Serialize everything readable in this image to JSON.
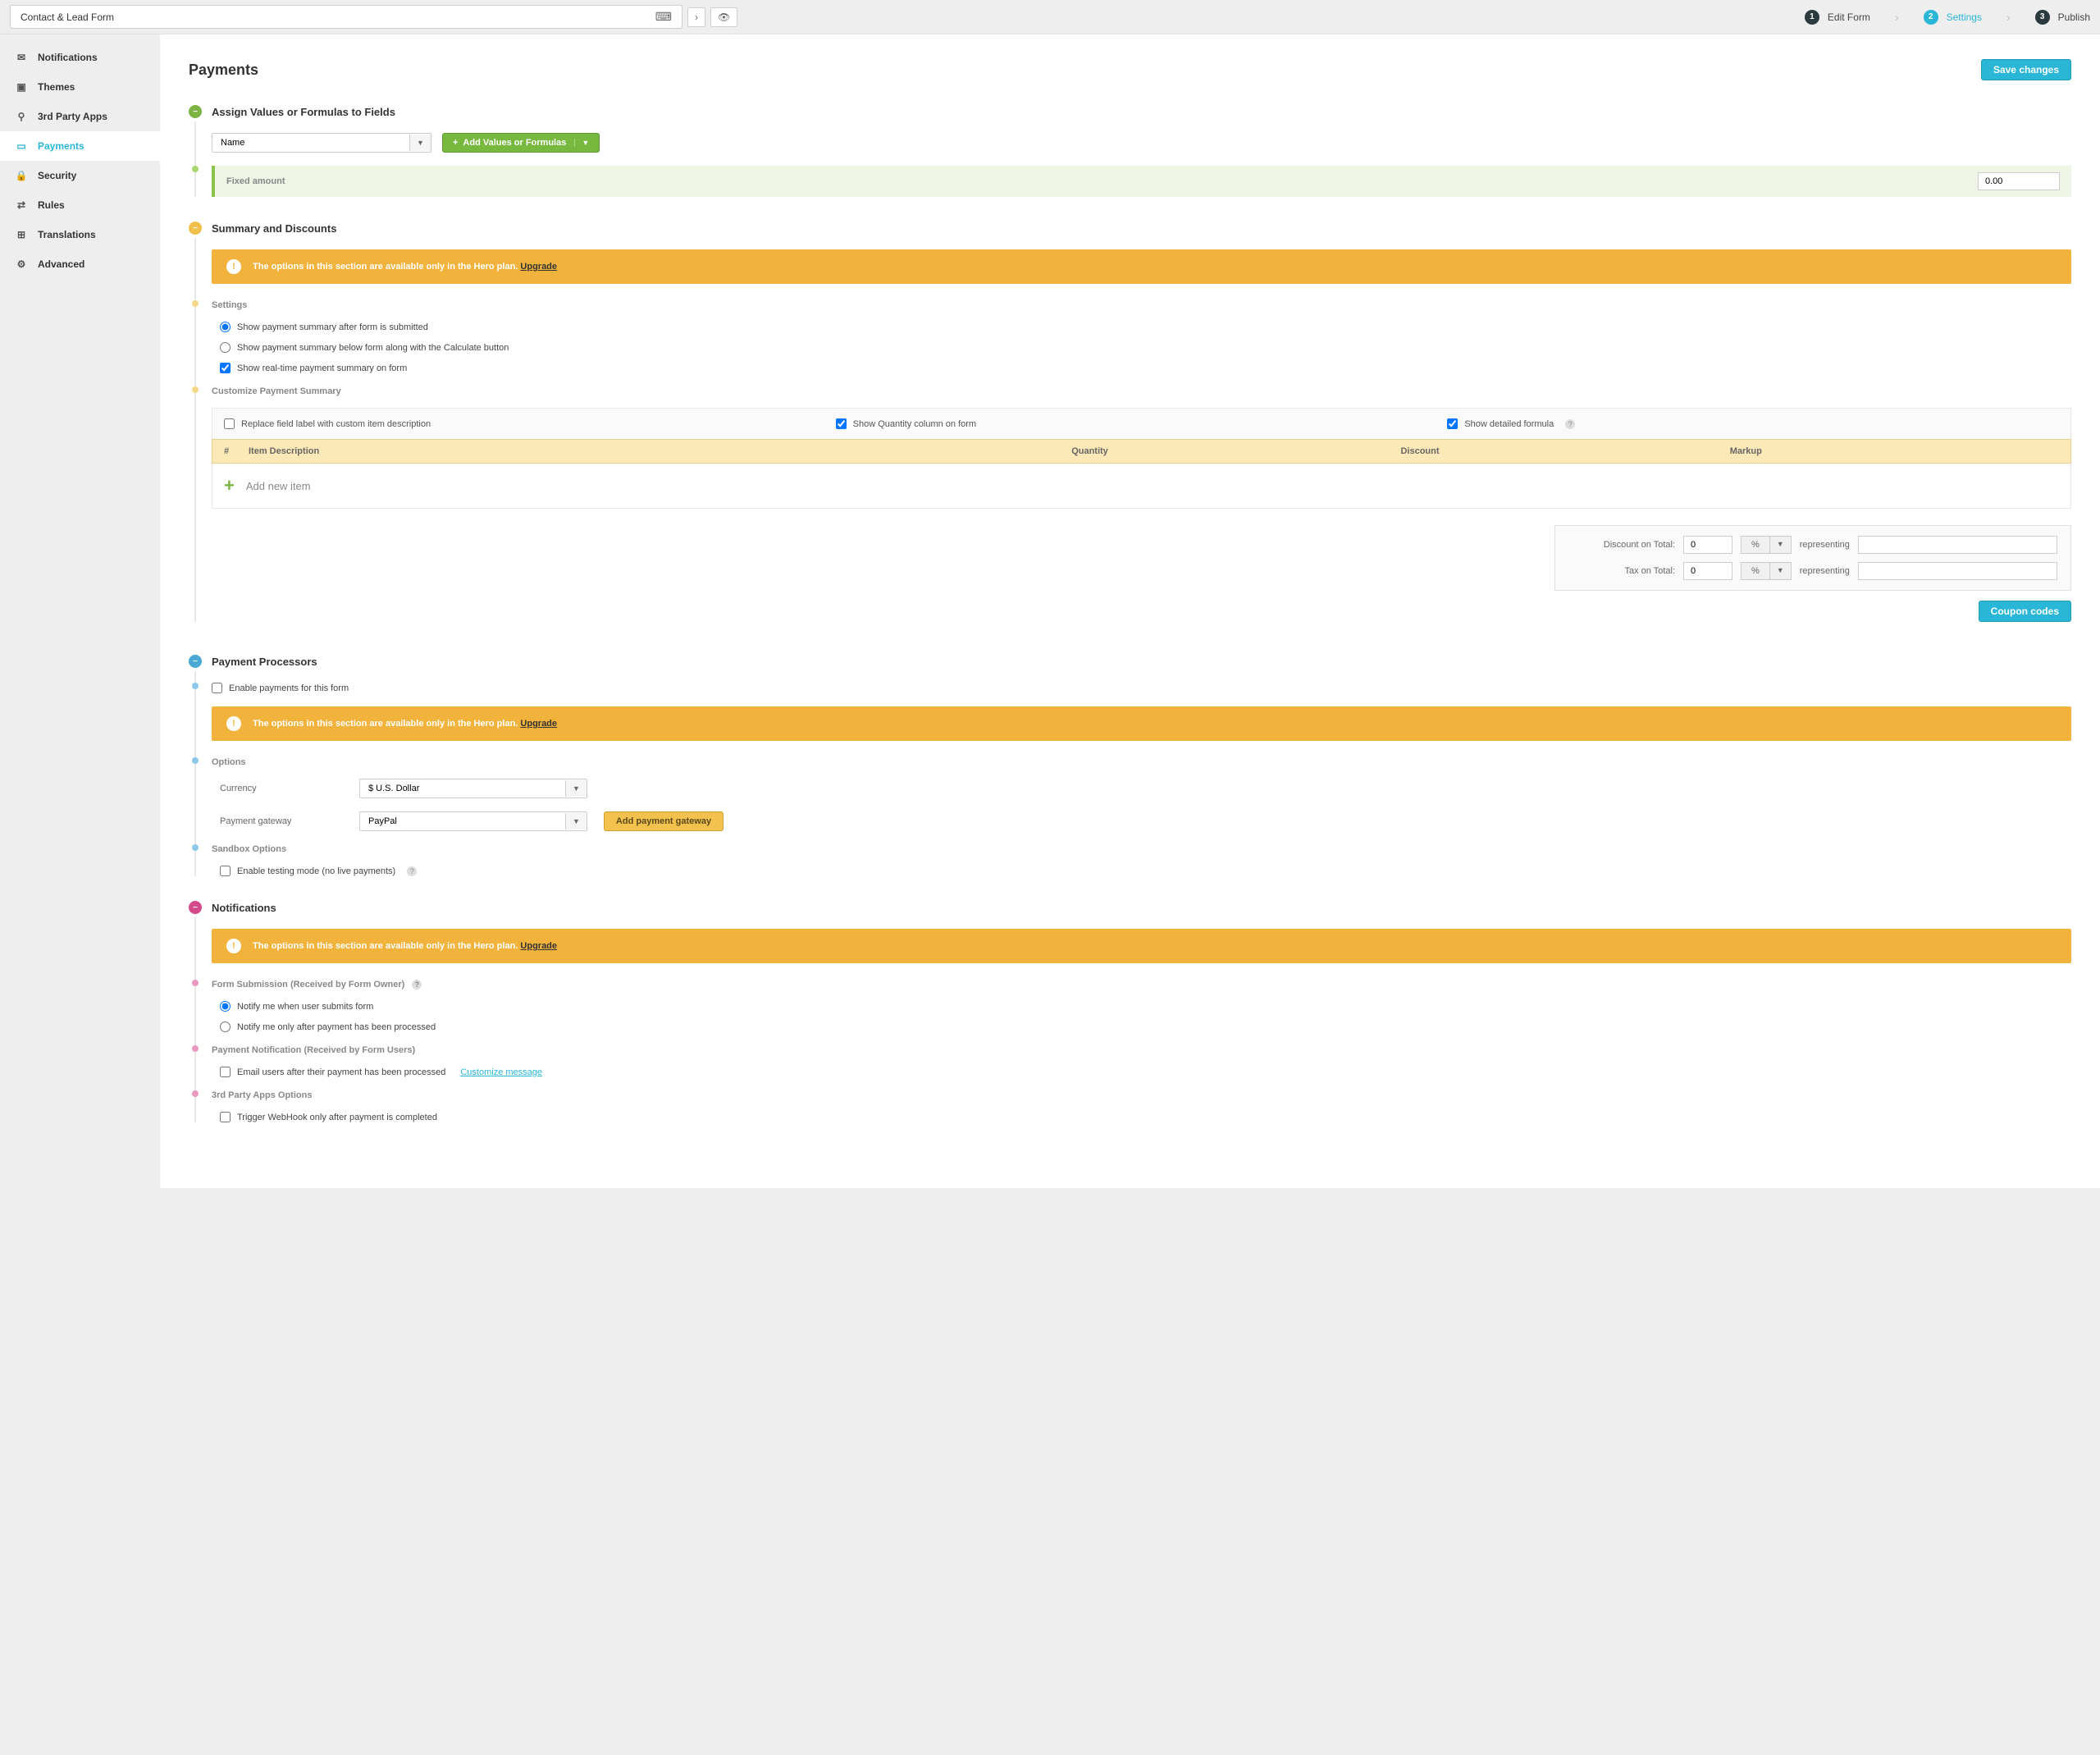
{
  "header": {
    "form_name": "Contact & Lead Form",
    "steps": {
      "s1": "Edit Form",
      "s2": "Settings",
      "s3": "Publish"
    }
  },
  "sidebar": {
    "notifications": "Notifications",
    "themes": "Themes",
    "third_party": "3rd Party Apps",
    "payments": "Payments",
    "security": "Security",
    "rules": "Rules",
    "translations": "Translations",
    "advanced": "Advanced"
  },
  "page": {
    "title": "Payments",
    "save": "Save changes"
  },
  "section1": {
    "title": "Assign Values or Formulas to Fields",
    "field_select": "Name",
    "add_btn": "Add Values or Formulas",
    "fixed_label": "Fixed amount",
    "fixed_value": "0.00"
  },
  "section2": {
    "title": "Summary and Discounts",
    "banner_text": "The options in this section are available only in the Hero plan.",
    "banner_link": "Upgrade",
    "settings_heading": "Settings",
    "opt1": "Show payment summary after form is submitted",
    "opt2": "Show payment summary below form along with the Calculate button",
    "opt3": "Show real-time payment summary on form",
    "customize_heading": "Customize Payment Summary",
    "tbl_opt1": "Replace field label with custom item description",
    "tbl_opt2": "Show Quantity column on form",
    "tbl_opt3": "Show detailed formula",
    "col1": "#",
    "col2": "Item Description",
    "col3": "Quantity",
    "col4": "Discount",
    "col5": "Markup",
    "add_item": "Add new item",
    "discount_label": "Discount on Total:",
    "tax_label": "Tax on Total:",
    "zero": "0",
    "pct": "%",
    "representing": "representing",
    "coupon_btn": "Coupon codes"
  },
  "section3": {
    "title": "Payment Processors",
    "enable": "Enable payments for this form",
    "banner_text": "The options in this section are available only in the Hero plan.",
    "banner_link": "Upgrade",
    "options_heading": "Options",
    "currency_label": "Currency",
    "currency_value": "$ U.S. Dollar",
    "gateway_label": "Payment gateway",
    "gateway_value": "PayPal",
    "add_gateway": "Add payment gateway",
    "sandbox_heading": "Sandbox Options",
    "sandbox_opt": "Enable testing mode (no live payments)"
  },
  "section4": {
    "title": "Notifications",
    "banner_text": "The options in this section are available only in the Hero plan.",
    "banner_link": "Upgrade",
    "h1": "Form Submission (Received by Form Owner)",
    "o1": "Notify me when user submits form",
    "o2": "Notify me only after payment has been processed",
    "h2": "Payment Notification (Received by Form Users)",
    "o3": "Email users after their payment has been processed",
    "o3_link": "Customize message",
    "h3": "3rd Party Apps Options",
    "o4": "Trigger WebHook only after payment is completed"
  }
}
